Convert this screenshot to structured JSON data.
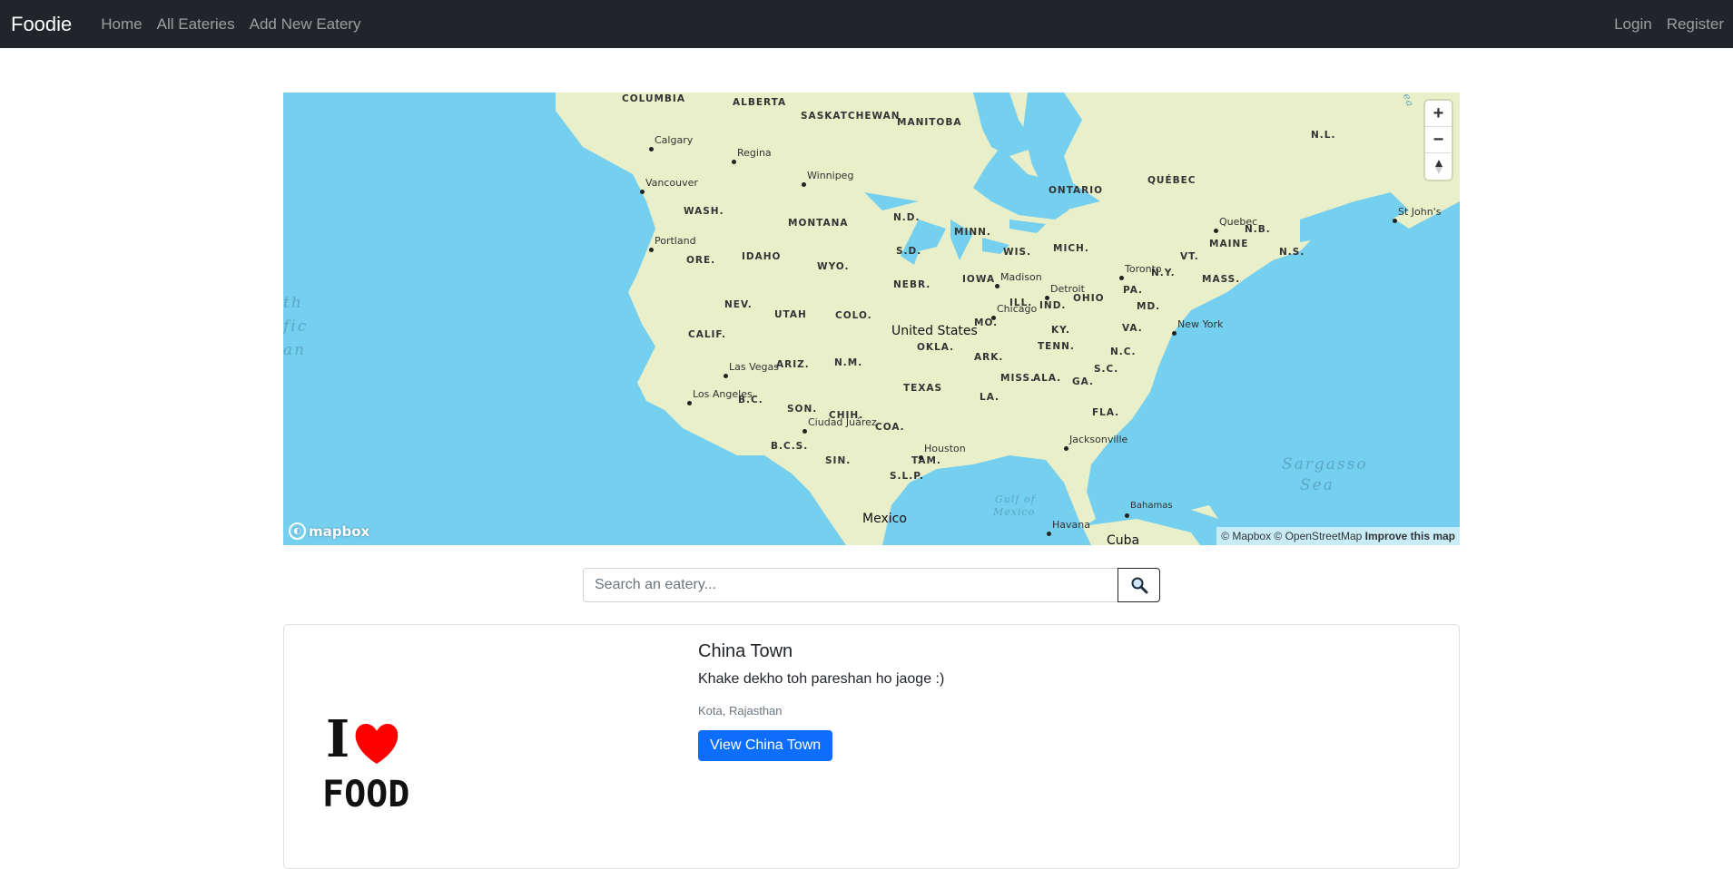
{
  "navbar": {
    "brand": "Foodie",
    "links": [
      "Home",
      "All Eateries",
      "Add New Eatery"
    ],
    "auth": [
      "Login",
      "Register"
    ]
  },
  "map": {
    "regions": [
      "COLUMBIA",
      "ALBERTA",
      "SASKATCHEWAN",
      "MANITOBA",
      "ONTARIO",
      "QUÉBEC",
      "N.L.",
      "N.B.",
      "N.S.",
      "WASH.",
      "MONTANA",
      "N.D.",
      "MINN.",
      "ORE.",
      "IDAHO",
      "WYO.",
      "S.D.",
      "WIS.",
      "MICH.",
      "VT.",
      "MAINE",
      "N.Y.",
      "MASS.",
      "NEBR.",
      "IOWA",
      "NEV.",
      "UTAH",
      "COLO.",
      "ILL.",
      "IND.",
      "OHIO",
      "PA.",
      "MD.",
      "CALIF.",
      "MO.",
      "KY.",
      "VA.",
      "OKLA.",
      "ARK.",
      "TENN.",
      "N.C.",
      "ARIZ.",
      "N.M.",
      "S.C.",
      "TEXAS",
      "MISS.",
      "ALA.",
      "GA.",
      "LA.",
      "B.C.",
      "SON.",
      "CHIH.",
      "COA.",
      "FLA.",
      "B.C.S.",
      "SIN.",
      "TAM.",
      "S.L.P."
    ],
    "cities": [
      "Calgary",
      "Regina",
      "Winnipeg",
      "Vancouver",
      "Portland",
      "Quebec",
      "St John's",
      "Toronto",
      "Madison",
      "Detroit",
      "Chicago",
      "New York",
      "Las Vegas",
      "Los Angeles",
      "Ciudad Juárez",
      "Houston",
      "Jacksonville",
      "Havana",
      "Bahamas"
    ],
    "countries": [
      "United States",
      "Mexico",
      "Cuba"
    ],
    "water": [
      "th",
      "fic",
      "an",
      "Sargasso",
      "Sea",
      "Gulf of",
      "Mexico",
      "ea"
    ],
    "zoom_in_icon": "plus-icon",
    "zoom_out_icon": "minus-icon",
    "compass_icon": "compass-icon",
    "logo": "mapbox",
    "attribution": "© Mapbox © OpenStreetMap",
    "improve": "Improve this map"
  },
  "search": {
    "placeholder": "Search an eatery...",
    "icon": "search-icon"
  },
  "eatery": {
    "title": "China Town",
    "description": "Khake dekho toh pareshan ho jaoge :)",
    "location": "Kota, Rajasthan",
    "button": "View China Town",
    "image_text_top": "I",
    "image_text_bottom": "FOOD"
  },
  "colors": {
    "navbar": "#212529",
    "water": "#75cfee",
    "land": "#e8efc9",
    "button": "#0d6efd",
    "heart": "#ff0000"
  }
}
